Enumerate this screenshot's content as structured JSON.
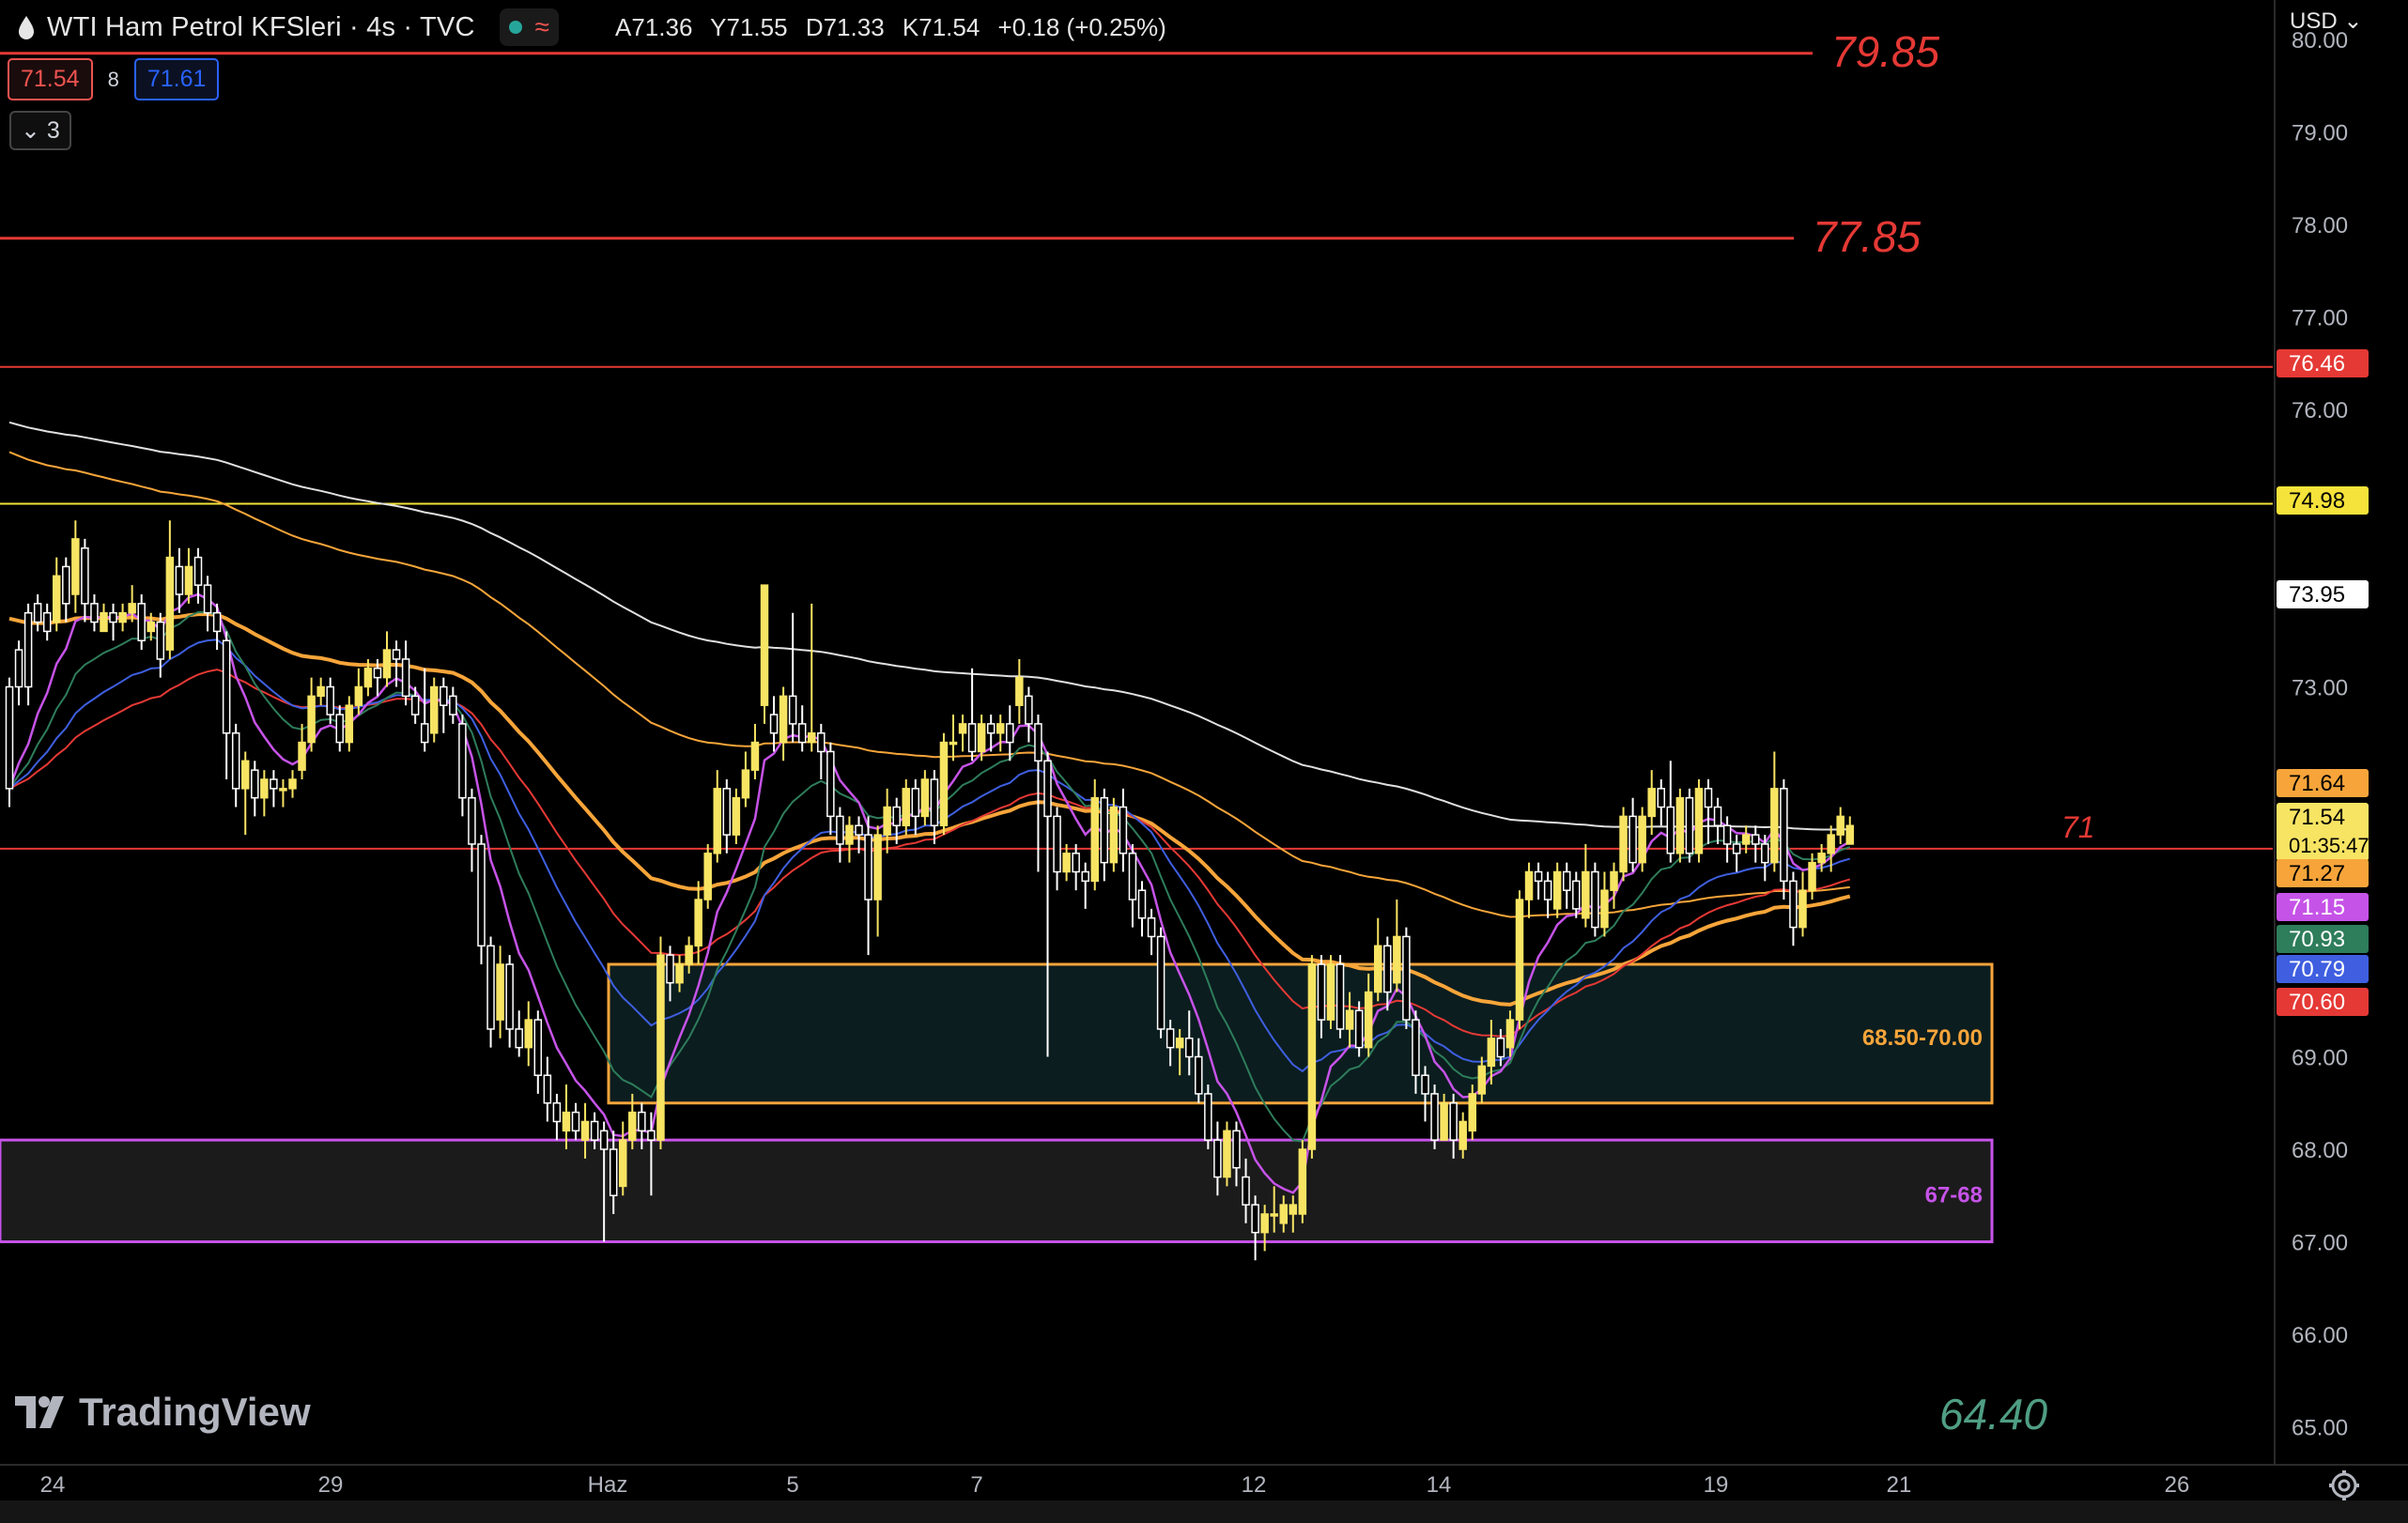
{
  "header": {
    "title": "WTI Ham Petrol KFSleri · 4s · TVC",
    "ohlc": {
      "open": "A71.36",
      "high": "Y71.55",
      "low": "D71.33",
      "close": "K71.54",
      "change": "+0.18 (+0.25%)"
    }
  },
  "trade": {
    "bid": "71.54",
    "spread": "8",
    "ask": "71.61"
  },
  "indicators_toggle": {
    "count": "3"
  },
  "currency": "USD",
  "logo": "TradingView",
  "colors": {
    "bull": "#f7e463",
    "bear": "#ffffff",
    "ema_white": "#e0e0e0",
    "ema_orange": "#f7a53a",
    "ema_red": "#e53935",
    "ema_blue": "#3f5fe0",
    "ema_green": "#2e7d5b",
    "ema_purple": "#c653e8",
    "zone1": "#f7a53a",
    "zone2": "#c653e8",
    "hline_red": "#e53935",
    "hline_yellow": "#f5e23a"
  },
  "chart_data": {
    "type": "candlestick",
    "ylim": [
      64.4,
      80.2
    ],
    "y_ticks": [
      "65.00",
      "66.00",
      "67.00",
      "68.00",
      "69.00",
      "70.00",
      "71.00",
      "72.00",
      "73.00",
      "74.00",
      "75.00",
      "76.00",
      "77.00",
      "78.00",
      "79.00",
      "80.00"
    ],
    "x_ticks": [
      "24",
      "29",
      "Haz",
      "5",
      "7",
      "12",
      "14",
      "19",
      "21",
      "26"
    ],
    "candles": [
      [
        73.0,
        71.9,
        73.1,
        71.7
      ],
      [
        73.4,
        73.0,
        73.5,
        72.8
      ],
      [
        73.8,
        73.0,
        73.9,
        72.8
      ],
      [
        73.9,
        73.7,
        74.0,
        73.6
      ],
      [
        73.8,
        73.6,
        73.9,
        73.5
      ],
      [
        73.7,
        74.2,
        74.4,
        73.6
      ],
      [
        74.3,
        73.9,
        74.4,
        73.7
      ],
      [
        74.0,
        74.6,
        74.8,
        73.8
      ],
      [
        74.5,
        73.9,
        74.6,
        73.7
      ],
      [
        73.9,
        73.7,
        74.0,
        73.6
      ],
      [
        73.6,
        73.8,
        73.9,
        73.6
      ],
      [
        73.8,
        73.7,
        73.9,
        73.5
      ],
      [
        73.7,
        73.8,
        73.9,
        73.6
      ],
      [
        73.8,
        73.9,
        74.1,
        73.7
      ],
      [
        73.9,
        73.5,
        74.0,
        73.4
      ],
      [
        73.6,
        73.7,
        73.8,
        73.5
      ],
      [
        73.7,
        73.3,
        73.8,
        73.1
      ],
      [
        73.4,
        74.4,
        74.8,
        73.3
      ],
      [
        74.3,
        74.0,
        74.5,
        73.8
      ],
      [
        74.0,
        74.3,
        74.5,
        73.9
      ],
      [
        74.4,
        74.1,
        74.5,
        73.9
      ],
      [
        74.1,
        73.8,
        74.2,
        73.6
      ],
      [
        73.8,
        73.6,
        73.9,
        73.4
      ],
      [
        73.5,
        72.5,
        73.6,
        72.0
      ],
      [
        72.5,
        71.9,
        72.6,
        71.7
      ],
      [
        71.9,
        72.2,
        72.3,
        71.4
      ],
      [
        72.1,
        71.8,
        72.2,
        71.6
      ],
      [
        71.8,
        72.0,
        72.1,
        71.6
      ],
      [
        72.0,
        71.9,
        72.1,
        71.7
      ],
      [
        71.9,
        71.9,
        72.0,
        71.7
      ],
      [
        71.9,
        72.0,
        72.1,
        71.8
      ],
      [
        72.1,
        72.4,
        72.6,
        72.0
      ],
      [
        72.4,
        72.9,
        73.1,
        72.3
      ],
      [
        72.9,
        73.0,
        73.1,
        72.8
      ],
      [
        73.0,
        72.7,
        73.1,
        72.6
      ],
      [
        72.7,
        72.4,
        72.8,
        72.3
      ],
      [
        72.4,
        72.8,
        72.9,
        72.3
      ],
      [
        72.8,
        73.0,
        73.2,
        72.7
      ],
      [
        73.0,
        73.2,
        73.3,
        72.9
      ],
      [
        73.2,
        73.1,
        73.3,
        72.9
      ],
      [
        73.1,
        73.4,
        73.6,
        73.0
      ],
      [
        73.4,
        73.3,
        73.5,
        73.0
      ],
      [
        73.3,
        72.9,
        73.5,
        72.8
      ],
      [
        72.9,
        72.7,
        73.0,
        72.6
      ],
      [
        72.6,
        72.4,
        73.2,
        72.3
      ],
      [
        72.5,
        73.0,
        73.1,
        72.4
      ],
      [
        73.0,
        72.8,
        73.1,
        72.5
      ],
      [
        72.9,
        72.7,
        73.0,
        72.6
      ],
      [
        72.6,
        71.8,
        72.7,
        71.6
      ],
      [
        71.8,
        71.3,
        71.9,
        71.0
      ],
      [
        71.3,
        70.2,
        71.4,
        70.0
      ],
      [
        70.2,
        69.3,
        70.3,
        69.1
      ],
      [
        69.4,
        70.0,
        70.2,
        69.2
      ],
      [
        70.0,
        69.3,
        70.1,
        69.1
      ],
      [
        69.3,
        69.1,
        69.5,
        69.0
      ],
      [
        69.1,
        69.4,
        69.6,
        68.9
      ],
      [
        69.4,
        68.8,
        69.5,
        68.6
      ],
      [
        68.8,
        68.5,
        69.0,
        68.3
      ],
      [
        68.5,
        68.3,
        68.6,
        68.1
      ],
      [
        68.2,
        68.4,
        68.7,
        68.0
      ],
      [
        68.4,
        68.2,
        68.5,
        68.1
      ],
      [
        68.1,
        68.3,
        68.5,
        67.9
      ],
      [
        68.3,
        68.1,
        68.4,
        68.0
      ],
      [
        68.2,
        68.0,
        68.3,
        67.0
      ],
      [
        68.0,
        67.5,
        68.2,
        67.3
      ],
      [
        67.6,
        68.1,
        68.3,
        67.5
      ],
      [
        68.1,
        68.4,
        68.6,
        68.0
      ],
      [
        68.4,
        68.2,
        68.5,
        68.0
      ],
      [
        68.2,
        68.1,
        68.4,
        67.5
      ],
      [
        68.1,
        70.1,
        70.3,
        68.0
      ],
      [
        70.1,
        69.8,
        70.2,
        69.6
      ],
      [
        69.8,
        70.0,
        70.1,
        69.7
      ],
      [
        70.0,
        70.2,
        70.3,
        69.9
      ],
      [
        70.2,
        70.7,
        70.9,
        70.0
      ],
      [
        70.7,
        71.2,
        71.3,
        70.6
      ],
      [
        71.2,
        71.9,
        72.1,
        71.1
      ],
      [
        71.9,
        71.4,
        72.0,
        71.2
      ],
      [
        71.4,
        71.8,
        71.9,
        71.3
      ],
      [
        71.8,
        72.1,
        72.3,
        71.7
      ],
      [
        72.1,
        72.4,
        72.6,
        72.0
      ],
      [
        72.8,
        74.1,
        74.1,
        72.6
      ],
      [
        72.7,
        72.5,
        72.9,
        72.3
      ],
      [
        72.4,
        72.9,
        73.0,
        72.2
      ],
      [
        72.9,
        72.6,
        73.8,
        72.4
      ],
      [
        72.6,
        72.4,
        72.8,
        72.3
      ],
      [
        72.4,
        72.5,
        73.9,
        72.3
      ],
      [
        72.5,
        72.3,
        72.6,
        72.0
      ],
      [
        72.3,
        71.6,
        72.4,
        71.4
      ],
      [
        71.6,
        71.3,
        71.7,
        71.1
      ],
      [
        71.3,
        71.5,
        71.6,
        71.1
      ],
      [
        71.5,
        71.4,
        71.6,
        71.2
      ],
      [
        71.4,
        70.7,
        71.6,
        70.1
      ],
      [
        70.7,
        71.4,
        71.5,
        70.3
      ],
      [
        71.4,
        71.7,
        71.9,
        71.2
      ],
      [
        71.7,
        71.5,
        71.8,
        71.3
      ],
      [
        71.5,
        71.9,
        72.0,
        71.4
      ],
      [
        71.9,
        71.6,
        72.0,
        71.4
      ],
      [
        71.6,
        72.0,
        72.1,
        71.5
      ],
      [
        72.0,
        71.5,
        72.1,
        71.3
      ],
      [
        71.5,
        72.4,
        72.5,
        71.4
      ],
      [
        72.4,
        72.4,
        72.7,
        72.2
      ],
      [
        72.5,
        72.6,
        72.7,
        72.3
      ],
      [
        72.6,
        72.3,
        73.2,
        72.2
      ],
      [
        72.3,
        72.6,
        72.7,
        72.2
      ],
      [
        72.6,
        72.5,
        72.7,
        72.3
      ],
      [
        72.5,
        72.6,
        72.7,
        72.3
      ],
      [
        72.6,
        72.4,
        72.8,
        72.2
      ],
      [
        72.8,
        73.1,
        73.3,
        72.6
      ],
      [
        72.9,
        72.6,
        73.0,
        72.4
      ],
      [
        72.6,
        72.2,
        72.7,
        71.0
      ],
      [
        72.2,
        71.6,
        72.3,
        69.0
      ],
      [
        71.6,
        71.0,
        71.7,
        70.8
      ],
      [
        71.0,
        71.2,
        71.3,
        70.9
      ],
      [
        71.2,
        71.0,
        71.3,
        70.8
      ],
      [
        71.0,
        70.9,
        71.1,
        70.6
      ],
      [
        70.9,
        71.8,
        72.0,
        70.8
      ],
      [
        71.8,
        71.1,
        71.9,
        70.9
      ],
      [
        71.1,
        71.7,
        71.8,
        71.0
      ],
      [
        71.7,
        71.2,
        71.9,
        71.0
      ],
      [
        71.2,
        70.7,
        71.3,
        70.4
      ],
      [
        70.8,
        70.5,
        70.9,
        70.3
      ],
      [
        70.5,
        70.3,
        70.6,
        70.1
      ],
      [
        70.3,
        69.3,
        70.4,
        69.2
      ],
      [
        69.3,
        69.1,
        69.4,
        68.9
      ],
      [
        69.1,
        69.2,
        69.3,
        68.8
      ],
      [
        69.2,
        69.0,
        69.5,
        68.8
      ],
      [
        69.0,
        68.6,
        69.2,
        68.5
      ],
      [
        68.6,
        68.1,
        68.7,
        68.0
      ],
      [
        68.1,
        67.7,
        68.3,
        67.5
      ],
      [
        67.7,
        68.2,
        68.3,
        67.6
      ],
      [
        68.2,
        67.8,
        68.3,
        67.6
      ],
      [
        67.7,
        67.4,
        67.9,
        67.2
      ],
      [
        67.4,
        67.1,
        67.5,
        66.8
      ],
      [
        67.1,
        67.3,
        67.4,
        66.9
      ],
      [
        67.3,
        67.3,
        67.6,
        67.1
      ],
      [
        67.2,
        67.4,
        67.5,
        67.1
      ],
      [
        67.3,
        67.4,
        67.5,
        67.1
      ],
      [
        67.3,
        68.0,
        68.1,
        67.2
      ],
      [
        68.0,
        70.0,
        70.1,
        67.9
      ],
      [
        70.0,
        69.4,
        70.1,
        69.2
      ],
      [
        69.4,
        70.0,
        70.1,
        69.3
      ],
      [
        70.0,
        69.3,
        70.1,
        69.2
      ],
      [
        69.3,
        69.5,
        69.7,
        69.1
      ],
      [
        69.5,
        69.1,
        69.6,
        69.0
      ],
      [
        69.1,
        69.7,
        69.9,
        69.0
      ],
      [
        69.7,
        70.2,
        70.5,
        69.6
      ],
      [
        70.2,
        69.7,
        70.3,
        69.5
      ],
      [
        69.8,
        70.3,
        70.7,
        69.7
      ],
      [
        70.3,
        69.4,
        70.4,
        69.3
      ],
      [
        69.4,
        68.8,
        69.5,
        68.6
      ],
      [
        68.8,
        68.6,
        68.9,
        68.3
      ],
      [
        68.6,
        68.1,
        68.7,
        68.0
      ],
      [
        68.1,
        68.5,
        68.6,
        68.1
      ],
      [
        68.5,
        68.1,
        68.6,
        67.9
      ],
      [
        68.0,
        68.3,
        68.4,
        67.9
      ],
      [
        68.2,
        68.6,
        68.7,
        68.1
      ],
      [
        68.6,
        68.9,
        69.0,
        68.5
      ],
      [
        68.9,
        69.2,
        69.4,
        68.7
      ],
      [
        69.2,
        69.0,
        69.3,
        68.9
      ],
      [
        69.1,
        69.4,
        69.5,
        69.0
      ],
      [
        69.4,
        70.7,
        70.8,
        69.3
      ],
      [
        70.7,
        71.0,
        71.1,
        70.5
      ],
      [
        71.0,
        70.9,
        71.1,
        70.7
      ],
      [
        70.9,
        70.7,
        71.0,
        70.5
      ],
      [
        70.6,
        71.0,
        71.1,
        70.5
      ],
      [
        71.0,
        70.8,
        71.1,
        70.6
      ],
      [
        70.9,
        70.6,
        71.0,
        70.5
      ],
      [
        70.5,
        71.0,
        71.3,
        70.4
      ],
      [
        71.0,
        70.4,
        71.1,
        70.3
      ],
      [
        70.4,
        70.8,
        71.0,
        70.3
      ],
      [
        70.8,
        71.0,
        71.1,
        70.6
      ],
      [
        71.0,
        71.6,
        71.7,
        70.9
      ],
      [
        71.6,
        71.1,
        71.8,
        71.0
      ],
      [
        71.1,
        71.6,
        71.7,
        71.0
      ],
      [
        71.6,
        71.9,
        72.1,
        71.4
      ],
      [
        71.9,
        71.7,
        72.0,
        71.5
      ],
      [
        71.7,
        71.2,
        72.2,
        71.1
      ],
      [
        71.2,
        71.8,
        71.9,
        71.1
      ],
      [
        71.8,
        71.2,
        71.9,
        71.1
      ],
      [
        71.2,
        71.9,
        72.0,
        71.1
      ],
      [
        71.9,
        71.7,
        72.0,
        71.3
      ],
      [
        71.7,
        71.5,
        71.8,
        71.3
      ],
      [
        71.5,
        71.3,
        71.6,
        71.1
      ],
      [
        71.3,
        71.2,
        71.4,
        71.0
      ],
      [
        71.3,
        71.4,
        71.5,
        71.2
      ],
      [
        71.4,
        71.3,
        71.5,
        71.1
      ],
      [
        71.3,
        71.1,
        71.4,
        70.9
      ],
      [
        71.1,
        71.9,
        72.3,
        71.0
      ],
      [
        71.9,
        70.9,
        72.0,
        70.7
      ],
      [
        70.9,
        70.4,
        71.0,
        70.2
      ],
      [
        70.4,
        70.8,
        71.0,
        70.3
      ],
      [
        70.8,
        71.1,
        71.2,
        70.7
      ],
      [
        71.1,
        71.2,
        71.3,
        71.0
      ],
      [
        71.2,
        71.4,
        71.5,
        71.0
      ],
      [
        71.4,
        71.6,
        71.7,
        71.3
      ],
      [
        71.3,
        71.5,
        71.6,
        71.3
      ]
    ],
    "horizontal_lines": [
      {
        "price": 79.85,
        "label": "79.85",
        "color": "#e53935"
      },
      {
        "price": 77.85,
        "label": "77.85",
        "color": "#e53935"
      },
      {
        "price": 76.46,
        "color": "#e53935"
      },
      {
        "price": 74.98,
        "color": "#f5e23a"
      },
      {
        "price": 71.25,
        "label": "71",
        "color": "#e53935"
      }
    ],
    "zones": [
      {
        "from": 68.5,
        "to": 70.0,
        "label": "68.50-70.00",
        "color": "#f7a53a"
      },
      {
        "from": 67.0,
        "to": 68.1,
        "label": "67-68",
        "color": "#c653e8"
      }
    ],
    "target_label": "64.40",
    "price_labels": [
      {
        "value": "76.46",
        "bg": "#e53935",
        "fg": "#ffffff"
      },
      {
        "value": "74.98",
        "bg": "#f5e23a",
        "fg": "#000000"
      },
      {
        "value": "73.95",
        "bg": "#ffffff",
        "fg": "#000000"
      },
      {
        "value": "71.64",
        "bg": "#f7a53a",
        "fg": "#000000"
      },
      {
        "value": "71.54",
        "sub": "01:35:47",
        "bg": "#f7e463",
        "fg": "#000000"
      },
      {
        "value": "71.27",
        "bg": "#f7a53a",
        "fg": "#000000"
      },
      {
        "value": "71.15",
        "bg": "#c653e8",
        "fg": "#ffffff"
      },
      {
        "value": "70.93",
        "bg": "#2e7d5b",
        "fg": "#ffffff"
      },
      {
        "value": "70.79",
        "bg": "#3f5fe0",
        "fg": "#ffffff"
      },
      {
        "value": "70.60",
        "bg": "#e53935",
        "fg": "#ffffff"
      }
    ]
  }
}
